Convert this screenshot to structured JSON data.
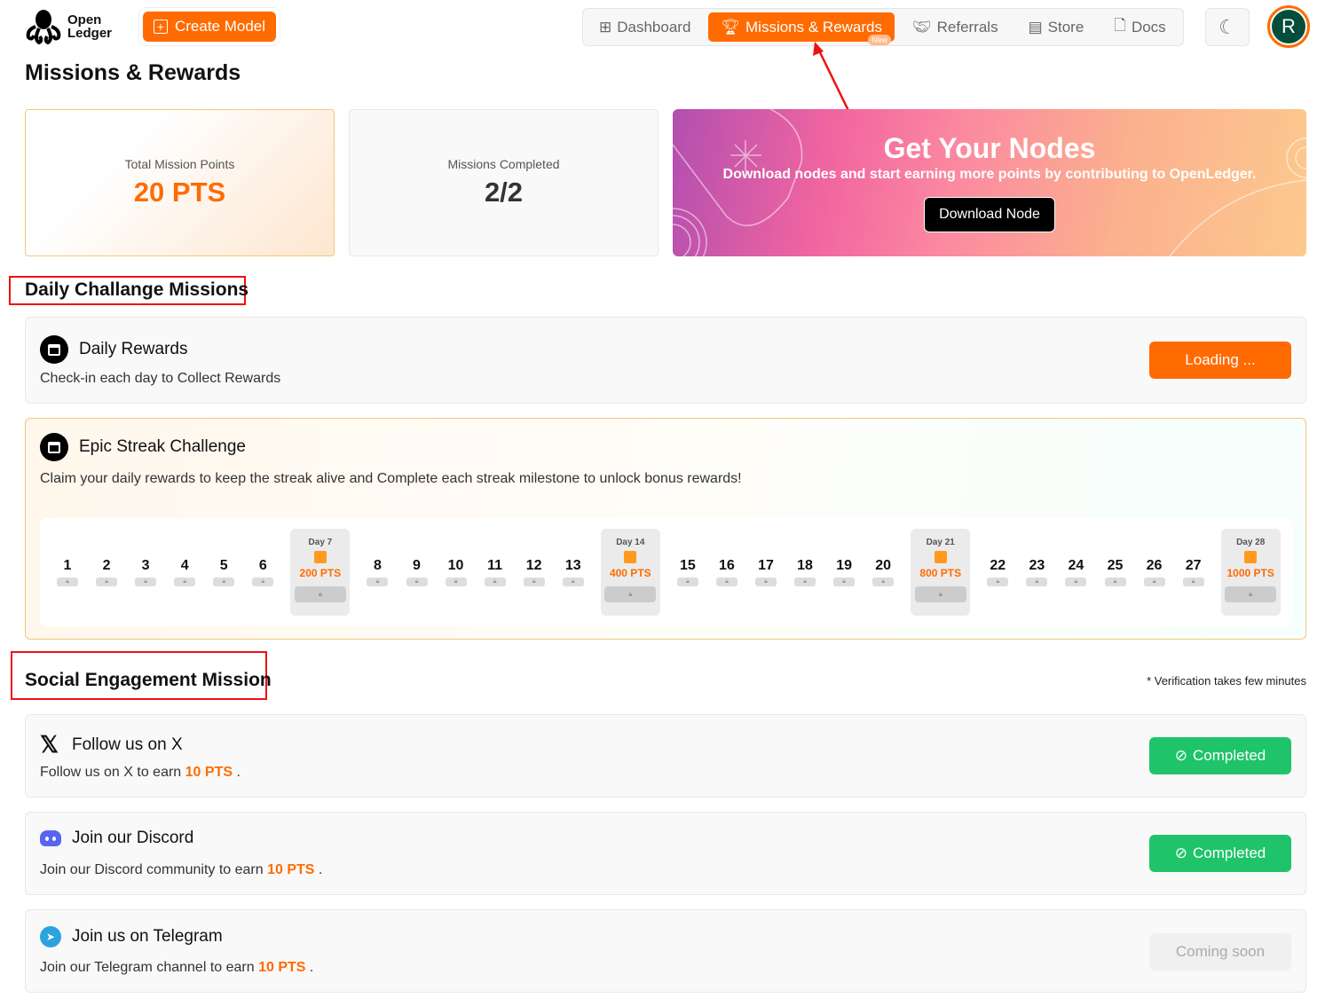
{
  "header": {
    "logo_line1": "Open",
    "logo_line2": "Ledger",
    "create_label": "Create Model",
    "nav": [
      {
        "label": "Dashboard",
        "icon": "grid-icon"
      },
      {
        "label": "Missions & Rewards",
        "icon": "trophy-icon",
        "badge": "New"
      },
      {
        "label": "Referrals",
        "icon": "handshake-icon"
      },
      {
        "label": "Store",
        "icon": "store-icon"
      },
      {
        "label": "Docs",
        "icon": "doc-icon"
      }
    ],
    "avatar": "R"
  },
  "page_title": "Missions & Rewards",
  "stats": {
    "points_label": "Total Mission Points",
    "points_value": "20 PTS",
    "missions_label": "Missions Completed",
    "missions_value": "2/2"
  },
  "banner": {
    "title": "Get Your Nodes",
    "text": "Download nodes and start earning more points by contributing to OpenLedger.",
    "button": "Download Node"
  },
  "daily": {
    "section_title": "Daily Challange Missions",
    "title": "Daily Rewards",
    "desc": "Check-in each day to Collect Rewards",
    "button": "Loading ..."
  },
  "streak": {
    "title": "Epic Streak Challenge",
    "desc": "Claim your daily rewards to keep the streak alive and Complete each streak milestone to unlock bonus rewards!",
    "days": [
      {
        "n": "1"
      },
      {
        "n": "2"
      },
      {
        "n": "3"
      },
      {
        "n": "4"
      },
      {
        "n": "5"
      },
      {
        "n": "6"
      },
      {
        "label": "Day 7",
        "pts": "200 PTS"
      },
      {
        "n": "8"
      },
      {
        "n": "9"
      },
      {
        "n": "10"
      },
      {
        "n": "11"
      },
      {
        "n": "12"
      },
      {
        "n": "13"
      },
      {
        "label": "Day 14",
        "pts": "400 PTS"
      },
      {
        "n": "15"
      },
      {
        "n": "16"
      },
      {
        "n": "17"
      },
      {
        "n": "18"
      },
      {
        "n": "19"
      },
      {
        "n": "20"
      },
      {
        "label": "Day 21",
        "pts": "800 PTS"
      },
      {
        "n": "22"
      },
      {
        "n": "23"
      },
      {
        "n": "24"
      },
      {
        "n": "25"
      },
      {
        "n": "26"
      },
      {
        "n": "27"
      },
      {
        "label": "Day 28",
        "pts": "1000 PTS"
      }
    ]
  },
  "social": {
    "section_title": "Social Engagement Mission",
    "note": "* Verification takes few minutes",
    "items": [
      {
        "title": "Follow us on X",
        "desc_pre": "Follow us on X to earn",
        "pts": "10 PTS",
        "desc_post": ".",
        "button": "Completed"
      },
      {
        "title": "Join our Discord",
        "desc_pre": "Join our Discord community to earn",
        "pts": "10 PTS",
        "desc_post": ".",
        "button": "Completed"
      },
      {
        "title": "Join us on Telegram",
        "desc_pre": "Join our Telegram channel to earn",
        "pts": "10 PTS",
        "desc_post": ".",
        "button": "Coming soon"
      }
    ]
  },
  "colors": {
    "accent": "#ff6b00",
    "success": "#1fc46a",
    "avatar_bg": "#034d3a"
  }
}
